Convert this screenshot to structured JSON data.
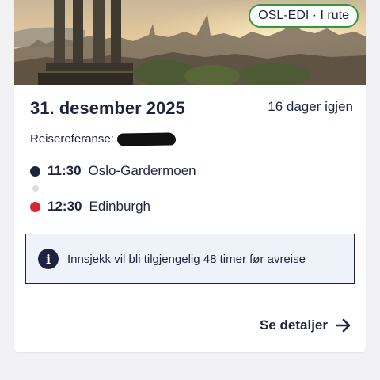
{
  "trip": {
    "route_status": "OSL-EDI · I rute",
    "date": "31. desember 2025",
    "days_left": "16 dager igjen",
    "reference_label": "Reisereferanse:",
    "departure": {
      "time": "11:30",
      "place": "Oslo-Gardermoen"
    },
    "arrival": {
      "time": "12:30",
      "place": "Edinburgh"
    }
  },
  "info": {
    "icon": "info-icon",
    "text": "Innsjekk vil bli tilgjengelig 48 timer før avreise"
  },
  "actions": {
    "details_label": "Se detaljer",
    "details_icon": "arrow-right-icon"
  },
  "colors": {
    "navy": "#1c2440",
    "status_green": "#2e9a3e",
    "arrival_red": "#d9262e",
    "info_bg": "#eef3fa"
  }
}
